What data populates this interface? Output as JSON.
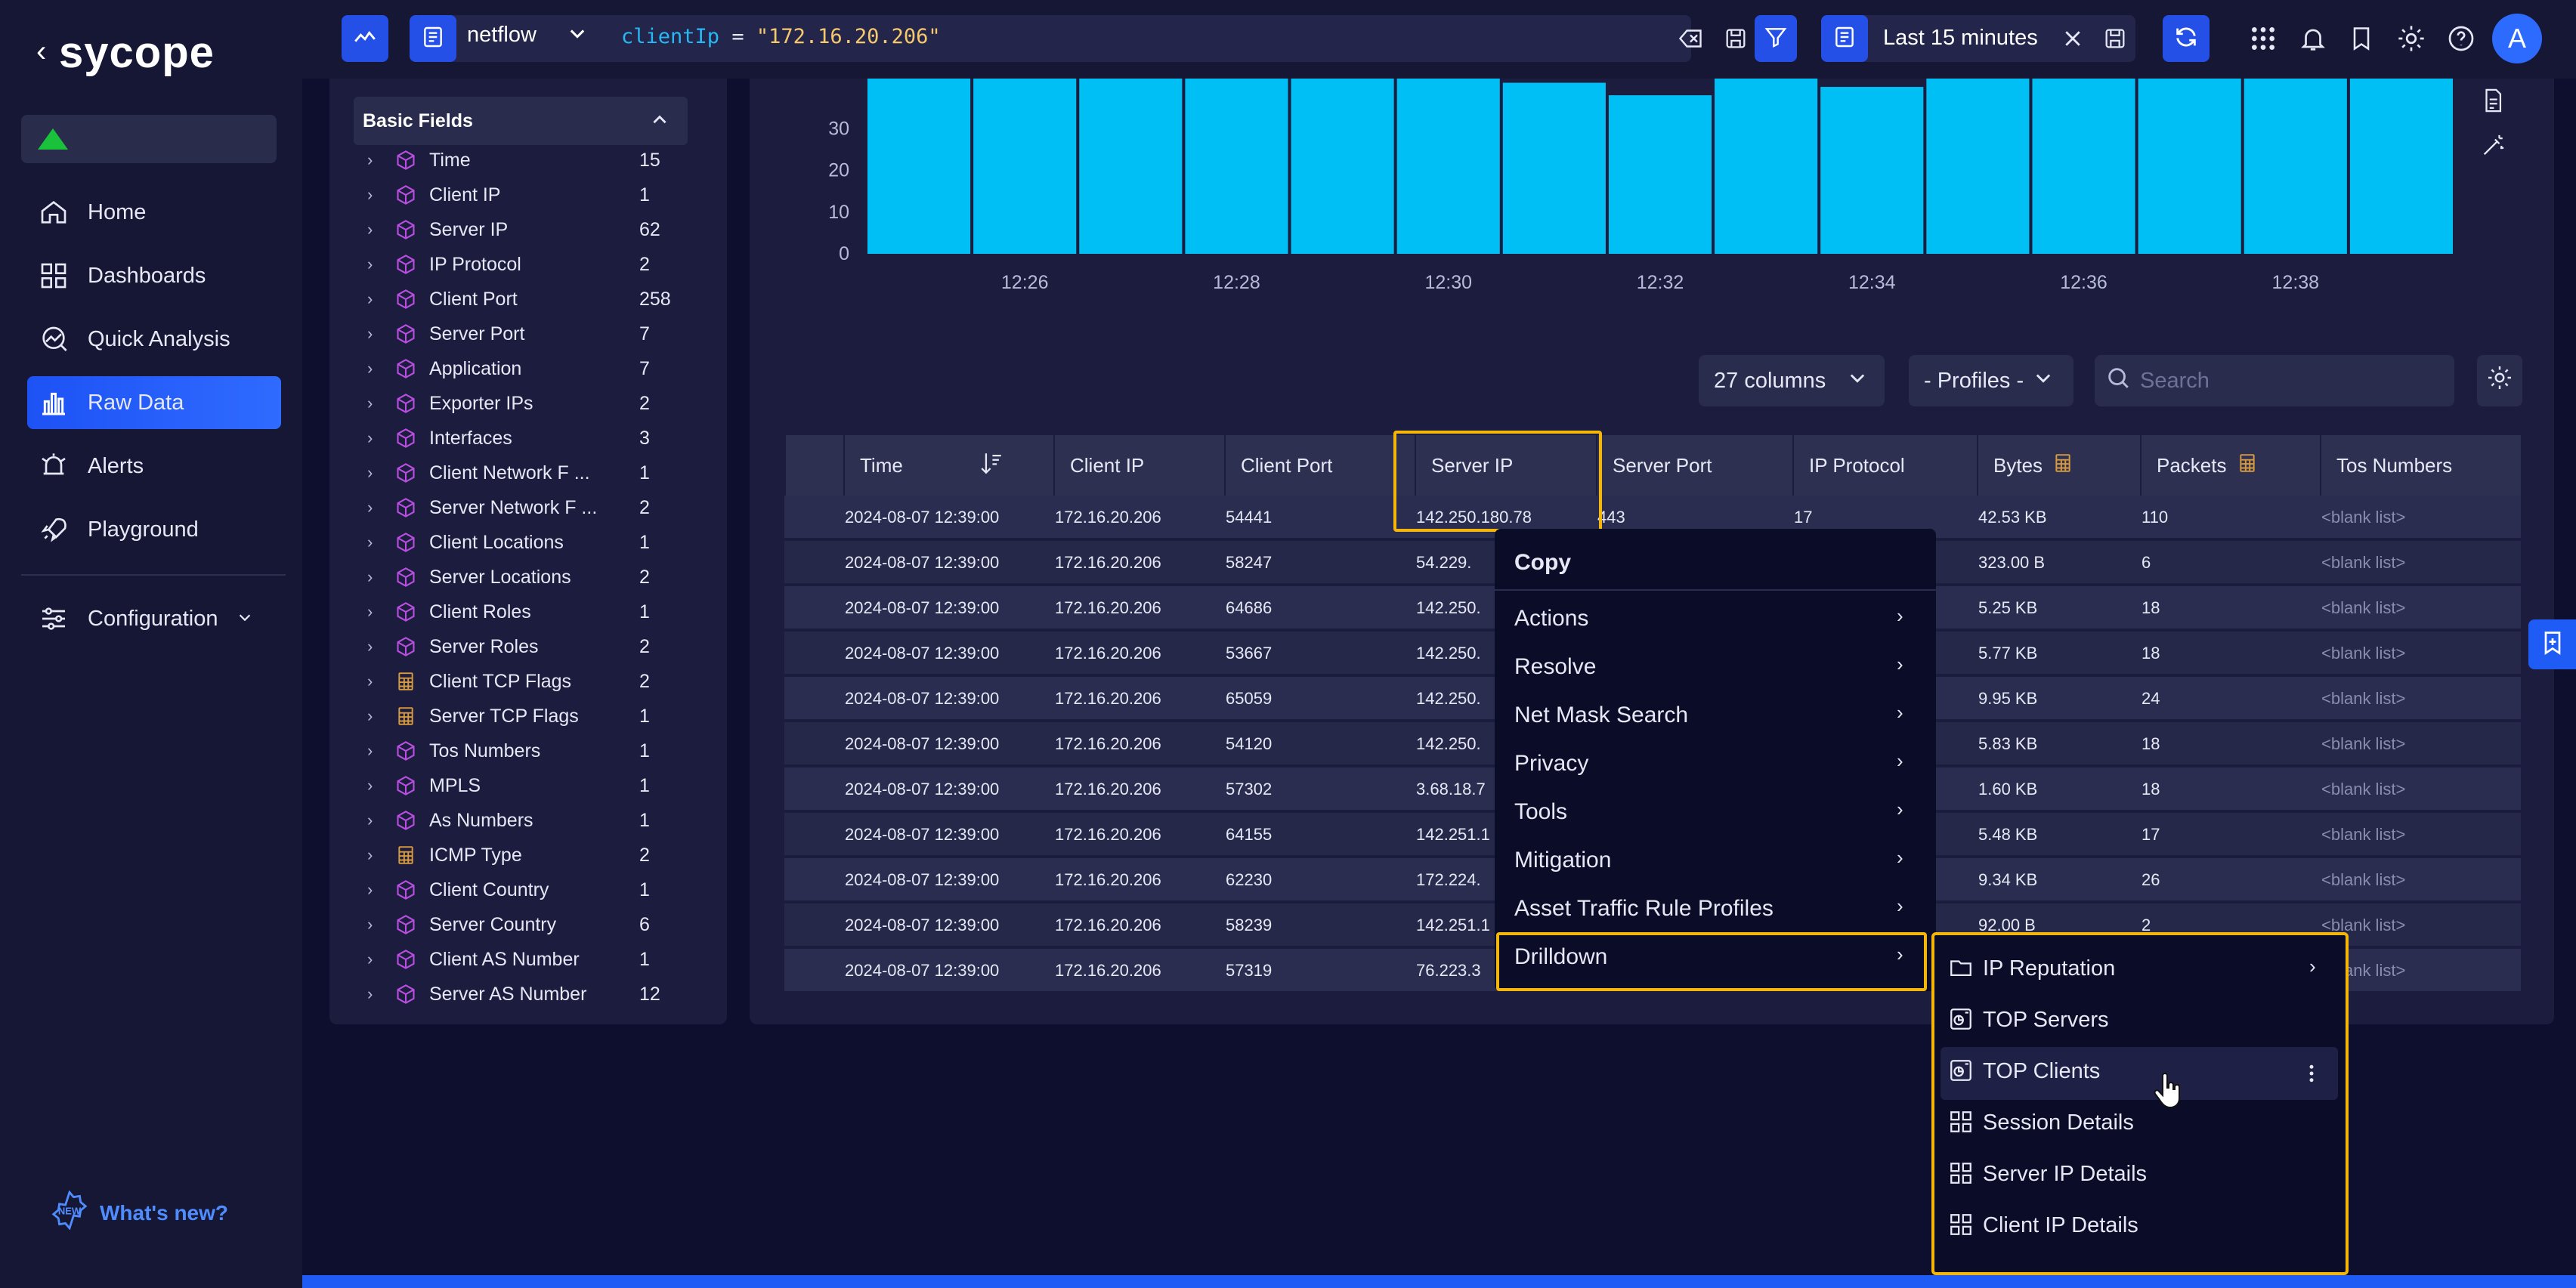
{
  "nav": {
    "logo": "sycope",
    "items": [
      {
        "label": "Home",
        "icon": "home-icon"
      },
      {
        "label": "Dashboards",
        "icon": "dashboards-icon"
      },
      {
        "label": "Quick Analysis",
        "icon": "quick-analysis-icon"
      },
      {
        "label": "Raw Data",
        "icon": "raw-data-icon",
        "active": true
      },
      {
        "label": "Alerts",
        "icon": "alerts-icon"
      },
      {
        "label": "Playground",
        "icon": "rocket-icon"
      },
      {
        "label": "Configuration",
        "icon": "sliders-icon"
      }
    ],
    "whats_new": "What's new?",
    "whats_new_badge": "NEW"
  },
  "topbar": {
    "source": "netflow",
    "query_key": "clientIp",
    "query_op": "=",
    "query_value": "\"172.16.20.206\"",
    "time_range": "Last 15 minutes",
    "avatar": "A"
  },
  "fields": {
    "header": "Basic Fields",
    "items": [
      {
        "name": "Time",
        "count": "15",
        "icon": "cube-icon"
      },
      {
        "name": "Client IP",
        "count": "1",
        "icon": "cube-icon"
      },
      {
        "name": "Server IP",
        "count": "62",
        "icon": "cube-icon"
      },
      {
        "name": "IP Protocol",
        "count": "2",
        "icon": "cube-icon"
      },
      {
        "name": "Client Port",
        "count": "258",
        "icon": "cube-icon"
      },
      {
        "name": "Server Port",
        "count": "7",
        "icon": "cube-icon"
      },
      {
        "name": "Application",
        "count": "7",
        "icon": "cube-icon"
      },
      {
        "name": "Exporter IPs",
        "count": "2",
        "icon": "cube-icon"
      },
      {
        "name": "Interfaces",
        "count": "3",
        "icon": "cube-icon"
      },
      {
        "name": "Client Network F ...",
        "count": "1",
        "icon": "cube-icon"
      },
      {
        "name": "Server Network F ...",
        "count": "2",
        "icon": "cube-icon"
      },
      {
        "name": "Client Locations",
        "count": "1",
        "icon": "cube-icon"
      },
      {
        "name": "Server Locations",
        "count": "2",
        "icon": "cube-icon"
      },
      {
        "name": "Client Roles",
        "count": "1",
        "icon": "cube-icon"
      },
      {
        "name": "Server Roles",
        "count": "2",
        "icon": "cube-icon"
      },
      {
        "name": "Client TCP Flags",
        "count": "2",
        "icon": "calculator-icon"
      },
      {
        "name": "Server TCP Flags",
        "count": "1",
        "icon": "calculator-icon"
      },
      {
        "name": "Tos Numbers",
        "count": "1",
        "icon": "cube-icon"
      },
      {
        "name": "MPLS",
        "count": "1",
        "icon": "cube-icon"
      },
      {
        "name": "As Numbers",
        "count": "1",
        "icon": "cube-icon"
      },
      {
        "name": "ICMP Type",
        "count": "2",
        "icon": "calculator-icon"
      },
      {
        "name": "Client Country",
        "count": "1",
        "icon": "cube-icon"
      },
      {
        "name": "Server Country",
        "count": "6",
        "icon": "cube-icon"
      },
      {
        "name": "Client AS Number",
        "count": "1",
        "icon": "cube-icon"
      },
      {
        "name": "Server AS Number",
        "count": "12",
        "icon": "cube-icon"
      }
    ]
  },
  "chart_data": {
    "type": "bar",
    "categories": [
      "12:25",
      "12:26",
      "12:27",
      "12:28",
      "12:29",
      "12:30",
      "12:31",
      "12:32",
      "12:33",
      "12:34",
      "12:35",
      "12:36",
      "12:37",
      "12:38",
      "12:39"
    ],
    "values": [
      42,
      42,
      42,
      42,
      42,
      42,
      41,
      38,
      42,
      40,
      42,
      42,
      42,
      42,
      42
    ],
    "x_tick_labels": [
      "12:26",
      "12:28",
      "12:30",
      "12:32",
      "12:34",
      "12:36",
      "12:38"
    ],
    "y_tick_labels": [
      "0",
      "10",
      "20",
      "30"
    ],
    "ylim": [
      0,
      42
    ],
    "color": "#00bff5"
  },
  "controls": {
    "columns": "27 columns",
    "profiles": "- Profiles -",
    "search_placeholder": "Search"
  },
  "table": {
    "headers": [
      "Time",
      "Client IP",
      "Client Port",
      "Server IP",
      "Server Port",
      "IP Protocol",
      "Bytes",
      "Packets",
      "Tos Numbers"
    ],
    "rows": [
      [
        "2024-08-07 12:39:00",
        "172.16.20.206",
        "54441",
        "142.250.180.78",
        "443",
        "17",
        "42.53 KB",
        "110",
        "<blank list>"
      ],
      [
        "2024-08-07 12:39:00",
        "172.16.20.206",
        "58247",
        "54.229.",
        "",
        "",
        "323.00 B",
        "6",
        "<blank list>"
      ],
      [
        "2024-08-07 12:39:00",
        "172.16.20.206",
        "64686",
        "142.250.",
        "",
        "",
        "5.25 KB",
        "18",
        "<blank list>"
      ],
      [
        "2024-08-07 12:39:00",
        "172.16.20.206",
        "53667",
        "142.250.",
        "",
        "",
        "5.77 KB",
        "18",
        "<blank list>"
      ],
      [
        "2024-08-07 12:39:00",
        "172.16.20.206",
        "65059",
        "142.250.",
        "",
        "",
        "9.95 KB",
        "24",
        "<blank list>"
      ],
      [
        "2024-08-07 12:39:00",
        "172.16.20.206",
        "54120",
        "142.250.",
        "",
        "",
        "5.83 KB",
        "18",
        "<blank list>"
      ],
      [
        "2024-08-07 12:39:00",
        "172.16.20.206",
        "57302",
        "3.68.18.7",
        "",
        "",
        "1.60 KB",
        "18",
        "<blank list>"
      ],
      [
        "2024-08-07 12:39:00",
        "172.16.20.206",
        "64155",
        "142.251.1",
        "",
        "",
        "5.48 KB",
        "17",
        "<blank list>"
      ],
      [
        "2024-08-07 12:39:00",
        "172.16.20.206",
        "62230",
        "172.224.",
        "",
        "",
        "9.34 KB",
        "26",
        "<blank list>"
      ],
      [
        "2024-08-07 12:39:00",
        "172.16.20.206",
        "58239",
        "142.251.1",
        "",
        "",
        "92.00 B",
        "2",
        "<blank list>"
      ],
      [
        "2024-08-07 12:39:00",
        "172.16.20.206",
        "57319",
        "76.223.3",
        "",
        "",
        "",
        "",
        "<blank list>"
      ]
    ]
  },
  "context_menu": {
    "title": "Copy",
    "items": [
      "Actions",
      "Resolve",
      "Net Mask Search",
      "Privacy",
      "Tools",
      "Mitigation",
      "Asset Traffic Rule Profiles",
      "Drilldown"
    ]
  },
  "submenu": {
    "items": [
      {
        "label": "IP Reputation",
        "icon": "folder-icon"
      },
      {
        "label": "TOP Servers",
        "icon": "chart-widget-icon"
      },
      {
        "label": "TOP Clients",
        "icon": "chart-widget-icon"
      },
      {
        "label": "Session Details",
        "icon": "grid-icon"
      },
      {
        "label": "Server IP Details",
        "icon": "grid-icon"
      },
      {
        "label": "Client IP Details",
        "icon": "grid-icon"
      }
    ]
  },
  "colors": {
    "accent": "#1e5cf5",
    "highlight": "#f5b60c",
    "bar": "#00bff5",
    "field_icon": "#b94fe0",
    "calc_icon": "#d79a3e"
  }
}
